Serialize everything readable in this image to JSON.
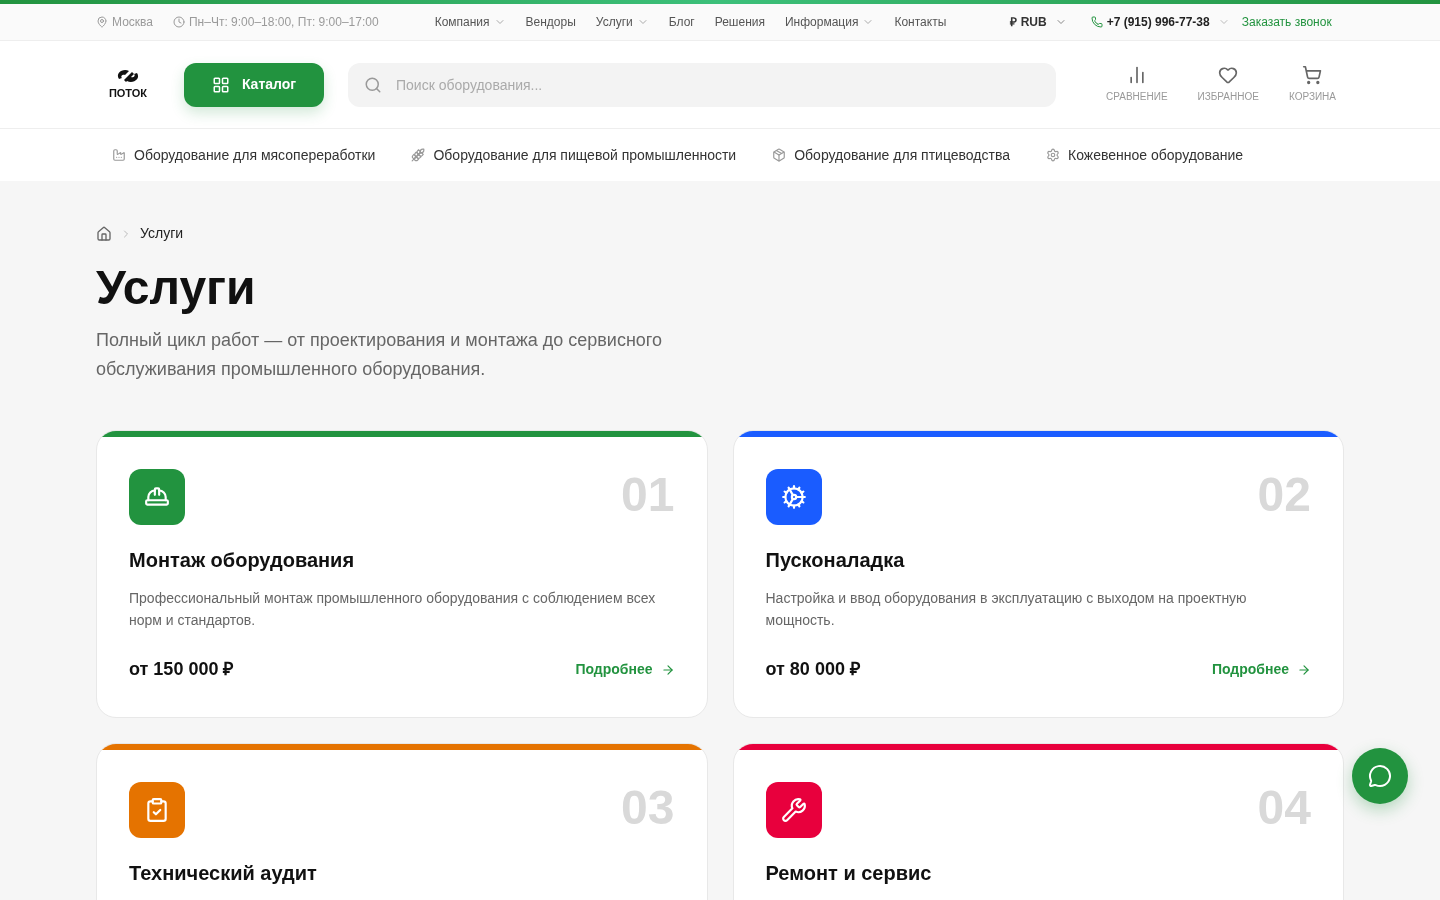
{
  "top_bar": {
    "city": "Москва",
    "hours": "Пн–Чт: 9:00–18:00, Пт: 9:00–17:00",
    "menu": [
      {
        "label": "Компания",
        "dropdown": true
      },
      {
        "label": "Вендоры",
        "dropdown": false
      },
      {
        "label": "Услуги",
        "dropdown": true
      },
      {
        "label": "Блог",
        "dropdown": false
      },
      {
        "label": "Решения",
        "dropdown": false
      },
      {
        "label": "Информация",
        "dropdown": true
      },
      {
        "label": "Контакты",
        "dropdown": false
      }
    ],
    "currency_symbol": "₽",
    "currency": "RUB",
    "phone": "+7 (915) 996-77-38",
    "callback": "Заказать звонок"
  },
  "header": {
    "logo": "ПОТОК",
    "catalog_button": "Каталог",
    "search": {
      "placeholder": "Поиск оборудования..."
    },
    "actions": [
      "СРАВНЕНИЕ",
      "ИЗБРАННОЕ",
      "КОРЗИНА"
    ]
  },
  "categories": [
    "Оборудование для мясопереработки",
    "Оборудование для пищевой промышленности",
    "Оборудование для птицеводства",
    "Кожевенное оборудование"
  ],
  "breadcrumbs": [
    "Услуги"
  ],
  "page": {
    "title": "Услуги",
    "description": "Полный цикл работ — от проектирования и монтажа до сервисного обслуживания промышленного оборудования."
  },
  "services": [
    {
      "number": "01",
      "title": "Монтаж оборудования",
      "color": "#22933f",
      "description": "Профессиональный монтаж промышленного оборудования с соблюдением всех норм и стандартов.",
      "price": "от 150 000 ₽",
      "link": "Подробнее"
    },
    {
      "number": "02",
      "title": "Пусконаладка",
      "color": "#1a5cff",
      "description": "Настройка и ввод оборудования в эксплуатацию с выходом на проектную мощность.",
      "price": "от 80 000 ₽",
      "link": "Подробнее"
    },
    {
      "number": "03",
      "title": "Технический аудит",
      "color": "#e57300"
    },
    {
      "number": "04",
      "title": "Ремонт и сервис",
      "color": "#e8003d"
    }
  ]
}
